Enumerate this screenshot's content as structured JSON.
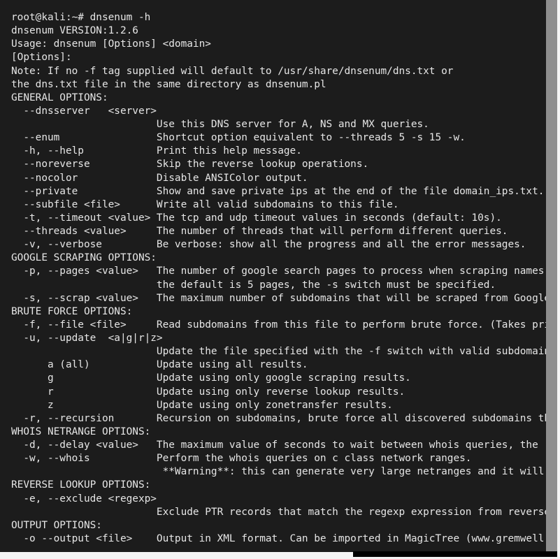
{
  "terminal": {
    "lines": [
      "root@kali:~# dnsenum -h",
      "dnsenum VERSION:1.2.6",
      "Usage: dnsenum [Options] <domain>",
      "[Options]:",
      "Note: If no -f tag supplied will default to /usr/share/dnsenum/dns.txt or",
      "the dns.txt file in the same directory as dnsenum.pl",
      "GENERAL OPTIONS:",
      "  --dnsserver   <server>",
      "                        Use this DNS server for A, NS and MX queries.",
      "  --enum                Shortcut option equivalent to --threads 5 -s 15 -w.",
      "  -h, --help            Print this help message.",
      "  --noreverse           Skip the reverse lookup operations.",
      "  --nocolor             Disable ANSIColor output.",
      "  --private             Show and save private ips at the end of the file domain_ips.txt.",
      "  --subfile <file>      Write all valid subdomains to this file.",
      "  -t, --timeout <value> The tcp and udp timeout values in seconds (default: 10s).",
      "  --threads <value>     The number of threads that will perform different queries.",
      "  -v, --verbose         Be verbose: show all the progress and all the error messages.",
      "GOOGLE SCRAPING OPTIONS:",
      "  -p, --pages <value>   The number of google search pages to process when scraping names,",
      "                        the default is 5 pages, the -s switch must be specified.",
      "  -s, --scrap <value>   The maximum number of subdomains that will be scraped from Google",
      "BRUTE FORCE OPTIONS:",
      "  -f, --file <file>     Read subdomains from this file to perform brute force. (Takes priority",
      "  -u, --update  <a|g|r|z>",
      "                        Update the file specified with the -f switch with valid subdomains.",
      "      a (all)           Update using all results.",
      "      g                 Update using only google scraping results.",
      "      r                 Update using only reverse lookup results.",
      "      z                 Update using only zonetransfer results.",
      "  -r, --recursion       Recursion on subdomains, brute force all discovered subdomains that",
      "WHOIS NETRANGE OPTIONS:",
      "  -d, --delay <value>   The maximum value of seconds to wait between whois queries, the",
      "  -w, --whois           Perform the whois queries on c class network ranges.",
      "                         **Warning**: this can generate very large netranges and it will",
      "REVERSE LOOKUP OPTIONS:",
      "  -e, --exclude <regexp>",
      "                        Exclude PTR records that match the regexp expression from reverse",
      "OUTPUT OPTIONS:",
      "  -o --output <file>    Output in XML format. Can be imported in MagicTree (www.gremwell.com)"
    ]
  }
}
